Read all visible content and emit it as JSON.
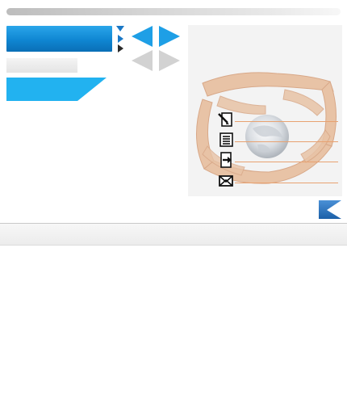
{
  "colors": {
    "accent_blue": "#0f86d2",
    "arrow_blue": "#1e9fe6",
    "arrow_gray": "#d2d2d2",
    "ribbon_blue": "#22b2f0",
    "menu_line": "#e8a271",
    "corner_blue": "#2a78c0"
  },
  "icons": {
    "nav": [
      "triangle-down-icon",
      "triangle-right-icon",
      "triangle-right-icon"
    ],
    "arrows": [
      "arrow-left-icon",
      "arrow-right-icon"
    ],
    "menu": [
      "edit-icon",
      "list-icon",
      "exit-icon",
      "mail-icon"
    ],
    "corner": "chevron-left-icon"
  },
  "panel": {
    "image": "hands-circle-globe-photo"
  }
}
